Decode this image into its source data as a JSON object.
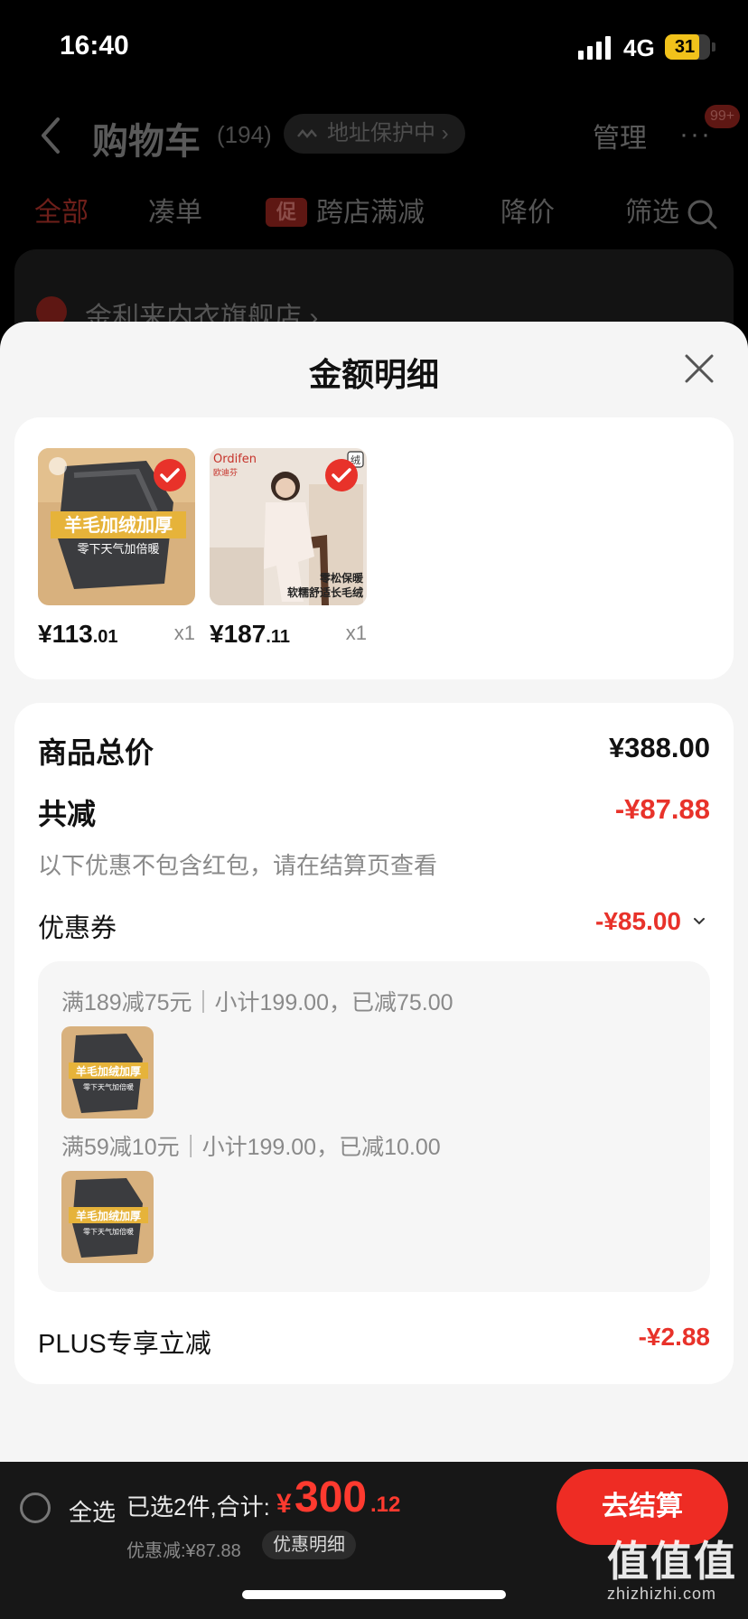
{
  "status_bar": {
    "time": "16:40",
    "network": "4G",
    "battery": "31"
  },
  "background_page": {
    "title": "购物车",
    "count": "(194)",
    "address_protection": "地址保护中",
    "manage": "管理",
    "more": "···",
    "badge": "99+",
    "tabs": [
      "全部",
      "凑单",
      "跨店满减",
      "降价",
      "筛选"
    ],
    "promo_tag": "促",
    "store_name": "金利来内衣旗舰店"
  },
  "sheet": {
    "title": "金额明细",
    "products": [
      {
        "price_int": "¥113",
        "price_dec": ".01",
        "qty": "x1",
        "overlay_main": "羊毛加绒加厚",
        "overlay_sub": "零下天气加倍暖"
      },
      {
        "price_int": "¥187",
        "price_dec": ".11",
        "qty": "x1",
        "brand": "Ordifen",
        "brand_cn": "欧迪芬",
        "tag": "绒",
        "caption_1": "零松保暖",
        "caption_2": "软糯舒适长毛绒"
      }
    ],
    "total_label": "商品总价",
    "total_value": "¥388.00",
    "discount_label": "共减",
    "discount_value": "-¥87.88",
    "discount_note": "以下优惠不包含红包，请在结算页查看",
    "coupon_label": "优惠券",
    "coupon_value": "-¥85.00",
    "coupons": [
      {
        "line": "满189减75元｜小计199.00，已减75.00"
      },
      {
        "line": "满59减10元｜小计199.00，已减10.00"
      }
    ],
    "coupon_thumb_main": "羊毛加绒加厚",
    "coupon_thumb_sub": "零下天气加倍暖",
    "plus_label": "PLUS专享立减",
    "plus_value": "-¥2.88"
  },
  "bottom_bar": {
    "select_all": "全选",
    "summary": "已选2件,合计:",
    "total_symbol": "¥",
    "total_int": "300",
    "total_dec": ".12",
    "saving": "优惠减:¥87.88",
    "detail_link": "优惠明细",
    "checkout": "去结算"
  },
  "watermark": {
    "logo": "值值值",
    "url": "zhizhizhi.com"
  },
  "colors": {
    "accent": "#e8322a",
    "checkout": "#ee2c24",
    "sheet_bg": "#f5f5f5",
    "bar_bg": "#171717"
  }
}
